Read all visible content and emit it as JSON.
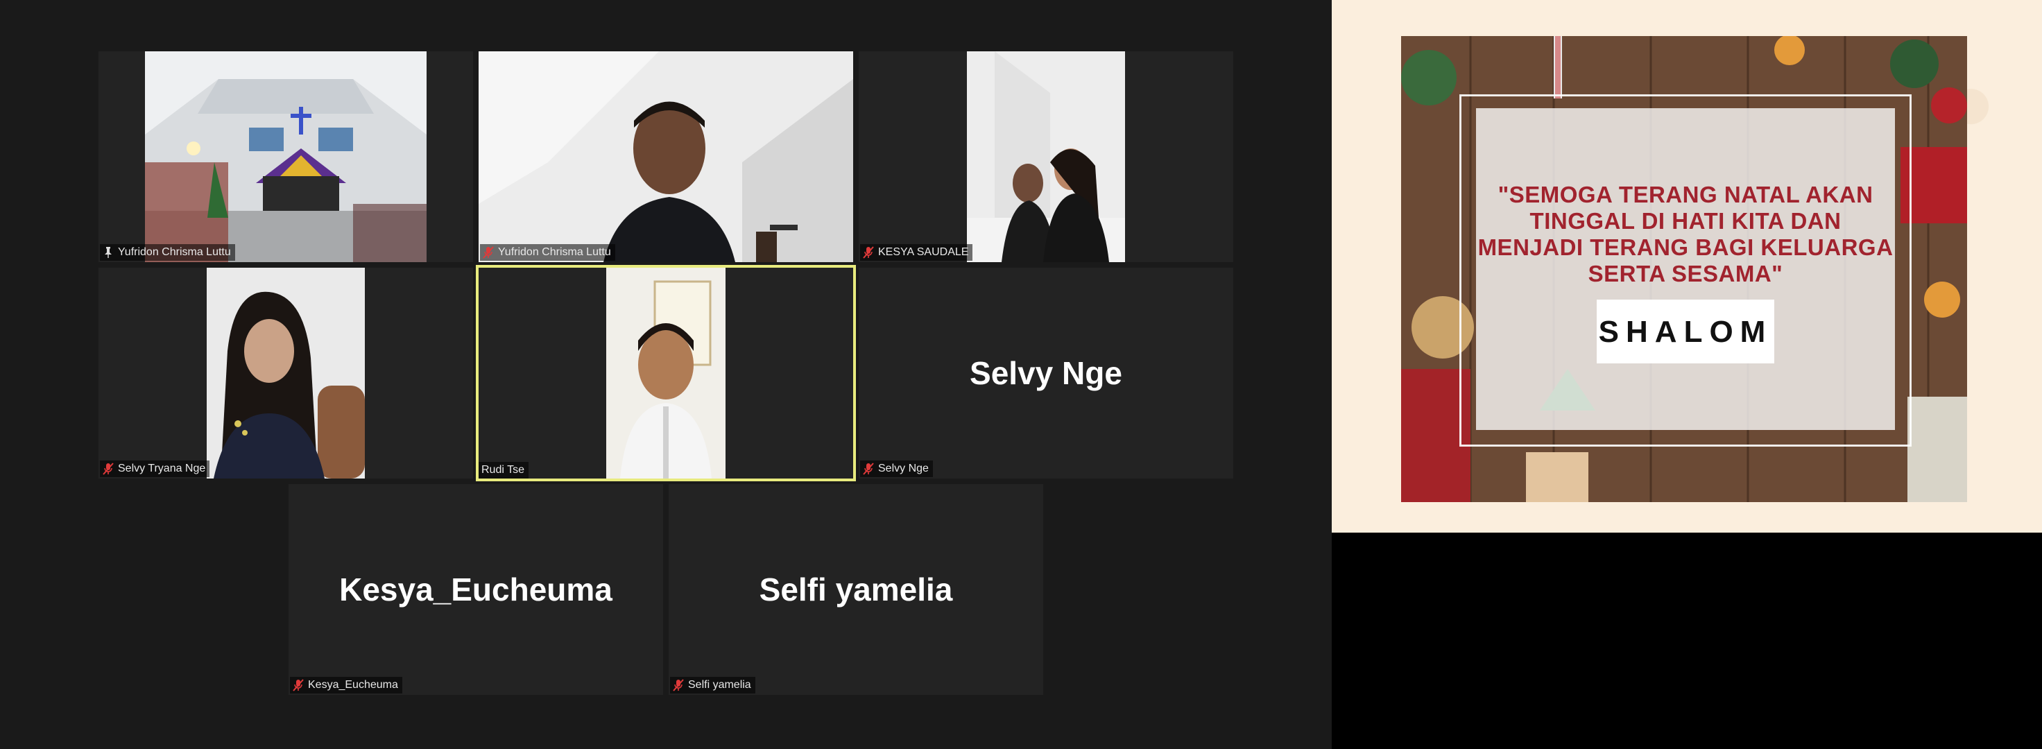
{
  "gallery": {
    "tiles": [
      {
        "name": "Yufridon Chrisma Luttu",
        "status_icon": "pin-icon",
        "video": "church-interior"
      },
      {
        "name": "Yufridon Chrisma Luttu",
        "status_icon": "mic-muted-icon",
        "video": "man-portrait"
      },
      {
        "name": "KESYA SAUDALE",
        "status_icon": "mic-muted-icon",
        "video": "two-women"
      },
      {
        "name": "Selvy Tryana Nge",
        "status_icon": "mic-muted-icon",
        "video": "woman-portrait"
      },
      {
        "name": "Rudi Tse",
        "status_icon": "none",
        "video": "man-smiling",
        "active_speaker": true
      },
      {
        "name": "Selvy Nge",
        "display_name": "Selvy Nge",
        "status_icon": "mic-muted-icon",
        "video": "off"
      },
      {
        "name": "Kesya_Eucheuma",
        "display_name": "Kesya_Eucheuma",
        "status_icon": "mic-muted-icon",
        "video": "off"
      },
      {
        "name": "Selfi yamelia",
        "display_name": "Selfi yamelia",
        "status_icon": "mic-muted-icon",
        "video": "off"
      }
    ],
    "colors": {
      "background": "#1a1a1a",
      "tile": "#232323",
      "active_border": "#e8eb7e",
      "muted": "#e03a3a"
    }
  },
  "shared_screen": {
    "quote": "\"SEMOGA TERANG NATAL AKAN TINGGAL DI HATI KITA DAN MENJADI TERANG BAGI KELUARGA SERTA SESAMA\"",
    "greeting": "SHALOM",
    "colors": {
      "quote_text": "#a1232e",
      "background": "#fbeedd"
    }
  }
}
